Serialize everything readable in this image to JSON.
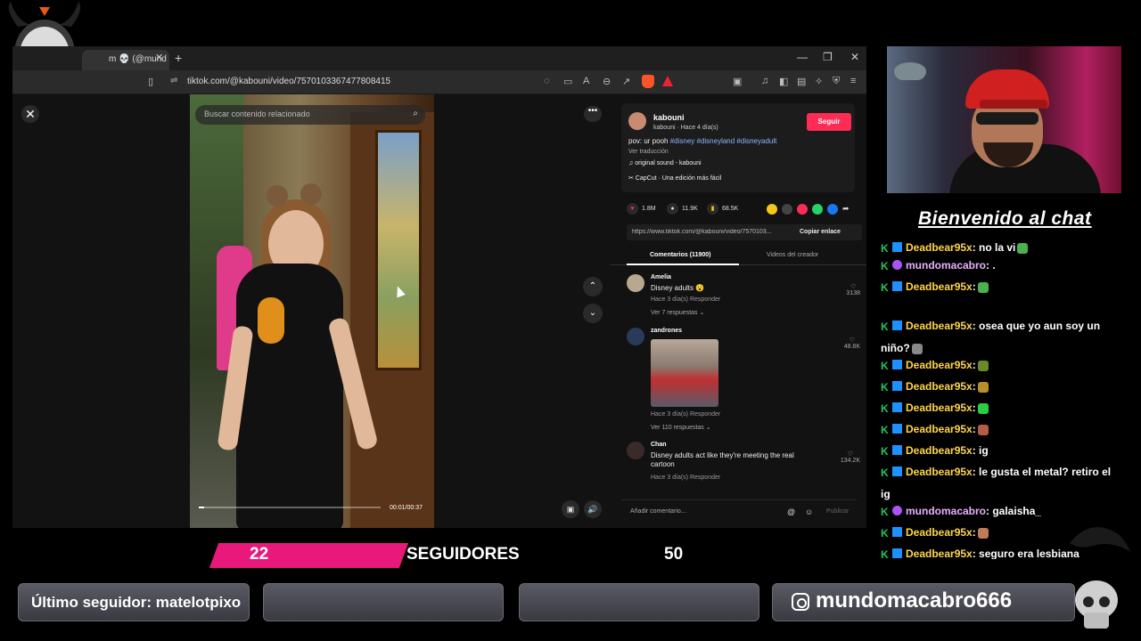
{
  "browser": {
    "tab_title": "m 💀 (@mund",
    "url": "tiktok.com/@kabouni/video/7570103367477808415"
  },
  "video": {
    "search_placeholder": "Buscar contenido relacionado",
    "time": "00:01/00:37",
    "progress": 0.03
  },
  "post": {
    "username": "kabouni",
    "subline": "kabouni · Hace 4 día(s)",
    "follow_label": "Seguir",
    "caption_text": "pov: ur pooh ",
    "caption_tags": "#disney #disneyland #disneyadult",
    "translate_label": "Ver traducción",
    "sound": "♫ original sound - kabouni",
    "capcut": "✂ CapCut · Una edición más fácil",
    "likes": "1.8M",
    "comments": "11.9K",
    "saves": "68.5K",
    "link_url": "https://www.tiktok.com/@kabouni/video/7570103...",
    "copy_link_label": "Copiar enlace",
    "tab_comments": "Comentarios (11900)",
    "tab_creator": "Videos del creador",
    "add_comment_placeholder": "Añadir comentario...",
    "publish_label": "Publicar"
  },
  "comments": [
    {
      "name": "Amelia",
      "text": "Disney adults 😮",
      "meta": "Hace 3 día(s)    Responder",
      "replies": "Ver 7 respuestas ⌄",
      "likes": "3138"
    },
    {
      "name": "zandrones",
      "text": "",
      "meta": "Hace 3 día(s)    Responder",
      "replies": "Ver 110 respuestas ⌄",
      "likes": "48.8K"
    },
    {
      "name": "Chan",
      "text": "Disney adults act like they're meeting the real cartoon",
      "meta": "Hace 3 día(s)    Responder",
      "replies": "",
      "likes": "134.2K"
    }
  ],
  "chat": {
    "welcome": "Bienvenido al chat",
    "messages": [
      {
        "author": "Deadbear95x",
        "text": ": no la vi",
        "emoji_color": "#4caf50",
        "purple": false
      },
      {
        "author": "mundomacabro",
        "text": ": .",
        "emoji_color": "",
        "purple": true
      },
      {
        "author": "Deadbear95x",
        "text": ":",
        "emoji_color": "#4caf50",
        "purple": false
      },
      {
        "author": "Deadbear95x",
        "text": ": osea que yo aun soy un niño?",
        "emoji_color": "#888888",
        "purple": false
      },
      {
        "author": "Deadbear95x",
        "text": ":",
        "emoji_color": "#6a8a2a",
        "purple": false
      },
      {
        "author": "Deadbear95x",
        "text": ":",
        "emoji_color": "#b8902a",
        "purple": false
      },
      {
        "author": "Deadbear95x",
        "text": ":",
        "emoji_color": "#2ecc40",
        "purple": false
      },
      {
        "author": "Deadbear95x",
        "text": ":",
        "emoji_color": "#b85a4a",
        "purple": false
      },
      {
        "author": "Deadbear95x",
        "text": ": ig",
        "emoji_color": "",
        "purple": false
      },
      {
        "author": "Deadbear95x",
        "text": ": le gusta el metal? retiro el ig",
        "emoji_color": "",
        "purple": false
      },
      {
        "author": "mundomacabro",
        "text": ": galaisha_",
        "emoji_color": "",
        "purple": true
      },
      {
        "author": "Deadbear95x",
        "text": ":",
        "emoji_color": "#c07a5a",
        "purple": false
      },
      {
        "author": "Deadbear95x",
        "text": ": seguro era lesbiana",
        "emoji_color": "",
        "purple": false
      }
    ]
  },
  "followers": {
    "current": "22",
    "label": "SEGUIDORES",
    "goal": "50"
  },
  "footer": {
    "last_follower": "Último seguidor: matelotpixo",
    "instagram": "mundomacabro666"
  },
  "colors": {
    "tiktok_red": "#fe2c55",
    "follower_pink": "#e8197a",
    "chat_author": "#ffd54a"
  }
}
